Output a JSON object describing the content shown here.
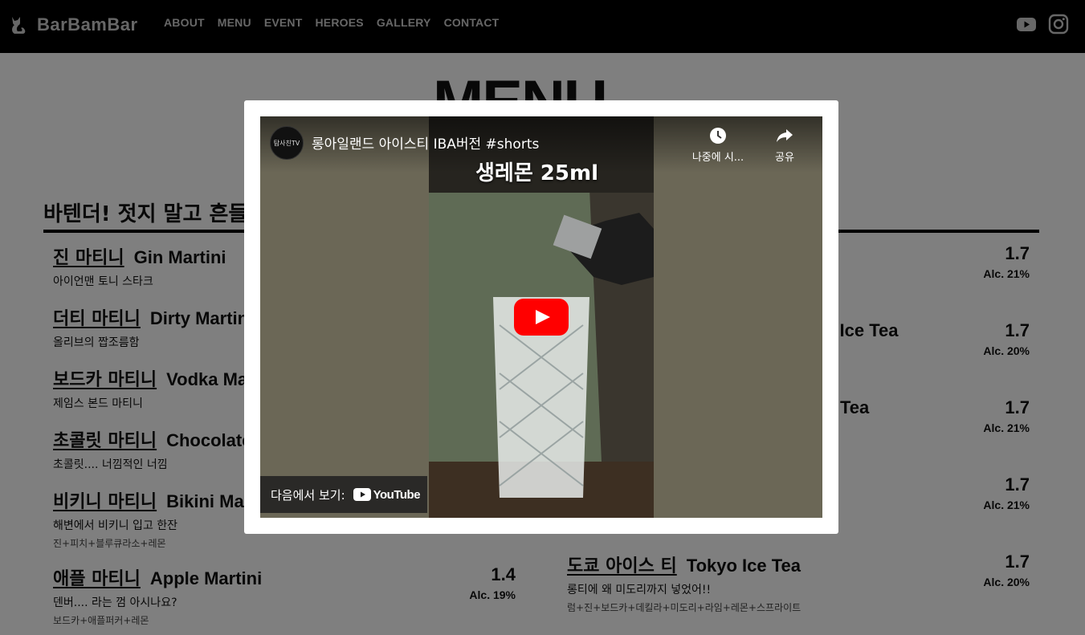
{
  "nav": {
    "brand": "BarBamBar",
    "links": [
      "ABOUT",
      "MENU",
      "EVENT",
      "HEROES",
      "GALLERY",
      "CONTACT"
    ]
  },
  "page": {
    "title": "MENU",
    "section_heading": "바텐더! 젓지 말고 흔들어줘"
  },
  "menu_left": [
    {
      "ko": "진 마티니",
      "en": "Gin Martini",
      "desc": "아이언맨 토니 스타크",
      "ing": "",
      "price": "",
      "alc": ""
    },
    {
      "ko": "더티 마티니",
      "en": "Dirty Martini",
      "desc": "올리브의 짭조름함",
      "ing": "",
      "price": "",
      "alc": ""
    },
    {
      "ko": "보드카 마티니",
      "en": "Vodka Martini",
      "desc": "제임스 본드 마티니",
      "ing": "",
      "price": "",
      "alc": ""
    },
    {
      "ko": "초콜릿 마티니",
      "en": "Chocolate Martini",
      "desc": "초콜릿.... 너낌적인 너낌",
      "ing": "",
      "price": "",
      "alc": ""
    },
    {
      "ko": "비키니 마티니",
      "en": "Bikini Martini",
      "desc": "해변에서 비키니 입고 한잔",
      "ing": "진+피치+블루큐라소+레몬",
      "price": "",
      "alc": ""
    },
    {
      "ko": "애플 마티니",
      "en": "Apple Martini",
      "desc": "덴버.... 라는 껌 아시나요?",
      "ing": "보드카+애플퍼커+레몬",
      "price": "1.4",
      "alc": "Alc. 19%"
    }
  ],
  "menu_right": [
    {
      "en": "",
      "price": "1.7",
      "alc": "Alc. 21%"
    },
    {
      "en": "d Ice Tea",
      "price": "1.7",
      "alc": "Alc. 20%"
    },
    {
      "en": "Tea",
      "price": "1.7",
      "alc": "Alc. 21%"
    },
    {
      "en": "",
      "price": "1.7",
      "alc": "Alc. 21%"
    },
    {
      "ko": "도쿄 아이스 티",
      "en": "Tokyo Ice Tea",
      "desc": "롱티에 왜 미도리까지 넣었어!!",
      "ing": "럼+진+보드카+데킬라+미도리+라임+레몬+스프라이트",
      "price": "1.7",
      "alc": "Alc. 20%"
    }
  ],
  "video": {
    "channel_avatar": "탐사친TV",
    "title": "롱아일랜드 아이스티 IBA버전 #shorts",
    "caption": "생레몬 25ml",
    "watch_later": "나중에 시...",
    "share": "공유",
    "watch_on": "다음에서 보기:",
    "youtube_word": "YouTube"
  },
  "colors": {
    "topbar": "#000000",
    "overlay": "rgba(0,0,0,0.5)",
    "youtube_red": "#ff0000"
  }
}
